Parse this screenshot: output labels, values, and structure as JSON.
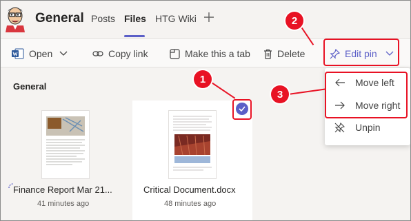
{
  "header": {
    "channel_title": "General",
    "tabs": [
      {
        "label": "Posts"
      },
      {
        "label": "Files"
      },
      {
        "label": "HTG Wiki"
      }
    ]
  },
  "toolbar": {
    "open_label": "Open",
    "copy_link_label": "Copy link",
    "make_tab_label": "Make this a tab",
    "delete_label": "Delete",
    "edit_pin_label": "Edit pin"
  },
  "section": {
    "title": "General"
  },
  "files": [
    {
      "name": "Finance Report Mar 21...",
      "time": "41 minutes ago"
    },
    {
      "name": "Critical Document.docx",
      "time": "48 minutes ago"
    }
  ],
  "menu": {
    "items": [
      {
        "label": "Move left",
        "icon": "arrow-left-icon"
      },
      {
        "label": "Move right",
        "icon": "arrow-right-icon"
      },
      {
        "label": "Unpin",
        "icon": "unpin-icon"
      }
    ]
  },
  "callouts": [
    "1",
    "2",
    "3"
  ],
  "colors": {
    "accent": "#5b5fc7",
    "annotation": "#e81224",
    "background": "#f5f3f1"
  }
}
